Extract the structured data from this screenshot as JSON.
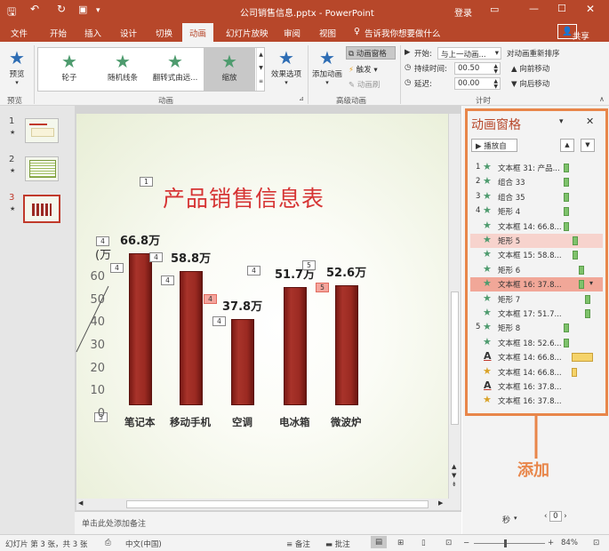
{
  "app": {
    "title": "公司销售信息.pptx  -  PowerPoint",
    "login": "登录",
    "share": "共享"
  },
  "tabs": [
    "文件",
    "开始",
    "插入",
    "设计",
    "切换",
    "动画",
    "幻灯片放映",
    "审阅",
    "视图"
  ],
  "tell_me": "告诉我你想要做什么",
  "ribbon": {
    "preview": "预览",
    "preview_group": "预览",
    "effects": [
      "轮子",
      "随机线条",
      "翻转式由远...",
      "缩放"
    ],
    "anim_group": "动画",
    "effect_options": "效果选项",
    "add_anim": "添加动画",
    "anim_pane_btn": "动画窗格",
    "trigger": "触发",
    "anim_painter": "动画刷",
    "adv_group": "高级动画",
    "start_label": "开始:",
    "start_value": "与上一动画...",
    "duration_label": "持续时间:",
    "duration_value": "00.50",
    "delay_label": "延迟:",
    "delay_value": "00.00",
    "reorder_title": "对动画重新排序",
    "move_earlier": "向前移动",
    "move_later": "向后移动",
    "timing_group": "计时"
  },
  "thumbnails": [
    {
      "num": "1",
      "star": "★"
    },
    {
      "num": "2",
      "star": "★"
    },
    {
      "num": "3",
      "star": "★"
    }
  ],
  "slide": {
    "title": "产品销售信息表",
    "title_tag": "1",
    "tags": {
      "t_paren": "4",
      "t_60": "4",
      "t_c1": "4",
      "t_c2a": "4",
      "t_c2b": "4",
      "t_c3a": "4",
      "t_c3b": "4",
      "t_c4a": "5",
      "t_c4b": "5",
      "t_c5": "5",
      "t_zero": "3"
    },
    "paren": "(万",
    "notes_placeholder": "单击此处添加备注"
  },
  "chart_data": {
    "type": "bar",
    "categories": [
      "笔记本",
      "移动手机",
      "空调",
      "电冰箱",
      "微波炉"
    ],
    "values": [
      66.8,
      58.8,
      37.8,
      51.7,
      52.6
    ],
    "data_labels": [
      "66.8万",
      "58.8万",
      "37.8万",
      "51.7万",
      "52.6万"
    ],
    "yticks": [
      "0",
      "10",
      "20",
      "30",
      "40",
      "50",
      "60"
    ],
    "ylim": [
      0,
      70
    ],
    "bar_color": "#9b2a22"
  },
  "anim_pane": {
    "title": "动画窗格",
    "play": "播放自",
    "rows": [
      {
        "num": "1",
        "icon": "star-green",
        "label": "文本框 31: 产品..."
      },
      {
        "num": "2",
        "icon": "star-green",
        "label": "组合 33"
      },
      {
        "num": "3",
        "icon": "star-green",
        "label": "组合 35"
      },
      {
        "num": "4",
        "icon": "star-green",
        "label": "矩形 4"
      },
      {
        "num": "",
        "icon": "star-green",
        "label": "文本框 14: 66.8..."
      },
      {
        "num": "",
        "icon": "star-green",
        "label": "矩形 5"
      },
      {
        "num": "",
        "icon": "star-green",
        "label": "文本框 15: 58.8..."
      },
      {
        "num": "",
        "icon": "star-green",
        "label": "矩形 6"
      },
      {
        "num": "",
        "icon": "star-green",
        "label": "文本框 16: 37.8..."
      },
      {
        "num": "",
        "icon": "star-green",
        "label": "矩形 7"
      },
      {
        "num": "",
        "icon": "star-green",
        "label": "文本框 17: 51.7..."
      },
      {
        "num": "5",
        "icon": "star-green",
        "label": "矩形 8"
      },
      {
        "num": "",
        "icon": "star-green",
        "label": "文本框 18: 52.6..."
      },
      {
        "num": "",
        "icon": "underline-a",
        "label": "文本框 14: 66.8..."
      },
      {
        "num": "",
        "icon": "star-gold",
        "label": "文本框 14: 66.8..."
      },
      {
        "num": "",
        "icon": "underline-a",
        "label": "文本框 16: 37.8..."
      },
      {
        "num": "",
        "icon": "star-gold",
        "label": "文本框 16: 37.8..."
      }
    ],
    "seconds_label": "秒",
    "zoom_value": "0"
  },
  "annotation": "添加",
  "status": {
    "slide_info": "幻灯片 第 3 张，共 3 张",
    "lang": "中文(中国)",
    "notes": "备注",
    "comments": "批注",
    "zoom": "84%"
  },
  "colors": {
    "accent": "#b7472a",
    "highlight": "#e8864a"
  }
}
